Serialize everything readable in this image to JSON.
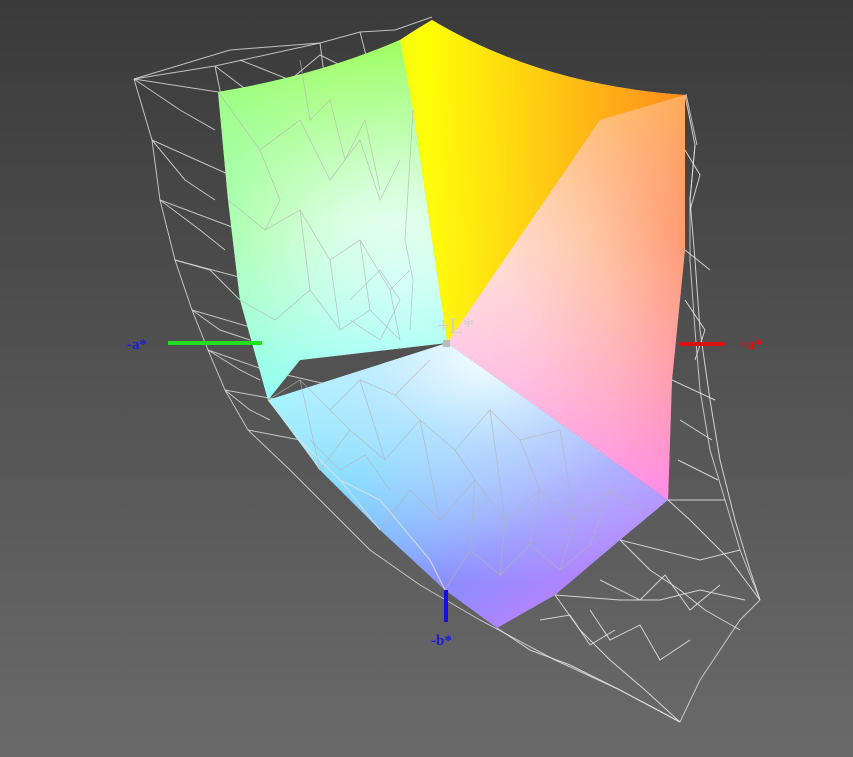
{
  "axes": {
    "neg_a": "-a*",
    "pos_a": "+a*",
    "neg_b": "-b*",
    "pos_l": "+L*"
  },
  "colors": {
    "background_top": "#3a3a3a",
    "background_bottom": "#6a6a6a",
    "axis_neg_a": "#20e020",
    "axis_pos_a": "#e01010",
    "axis_neg_b": "#1010e0",
    "axis_l": "#bbbbbb",
    "wireframe": "#d8d8d8"
  }
}
